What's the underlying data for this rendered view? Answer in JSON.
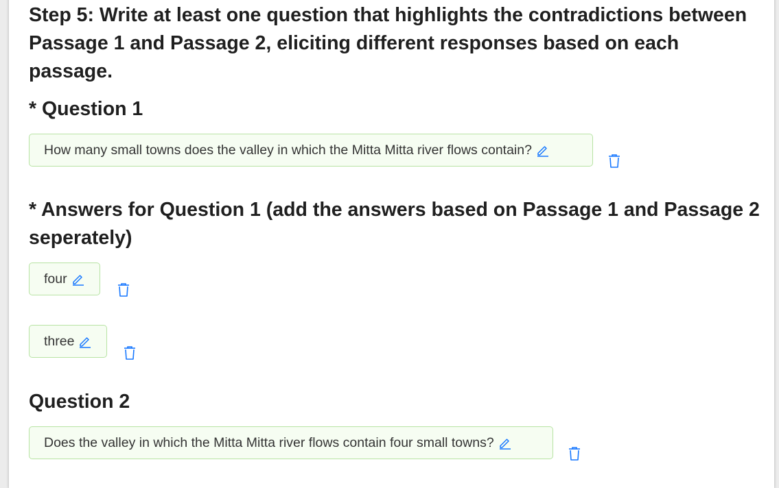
{
  "step": {
    "title": "Step 5: Write at least one question that highlights the contradictions between Passage 1 and Passage 2, eliciting different responses based on each passage."
  },
  "question1": {
    "heading": "* Question 1",
    "text": "How many small towns does the valley in which the Mitta Mitta river flows contain?"
  },
  "answers1": {
    "heading": "* Answers for Question 1 (add the answers based on Passage 1 and Passage 2 seperately)",
    "items": [
      "four",
      "three"
    ]
  },
  "question2": {
    "heading": "Question 2",
    "text": "Does the valley in which the Mitta Mitta river flows contain four small towns?"
  },
  "icons": {
    "edit": "edit-pencil-icon",
    "delete": "trash-icon"
  },
  "colors": {
    "accent": "#1677ff",
    "pill_border": "#b7e3a3",
    "pill_background": "#f6fdf2"
  }
}
